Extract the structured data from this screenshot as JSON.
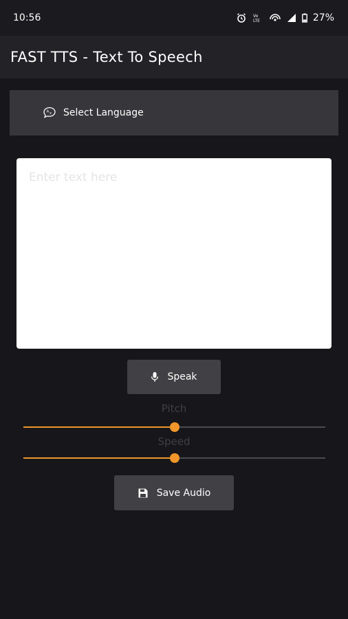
{
  "status_bar": {
    "time": "10:56",
    "network_label": "Vo)) LTE",
    "battery": "27%"
  },
  "app_bar": {
    "title": "FAST TTS - Text To Speech"
  },
  "language": {
    "label": "Select Language",
    "icon": "translate-chat-icon"
  },
  "text_input": {
    "placeholder": "Enter text here",
    "value": ""
  },
  "speak_button": {
    "label": "Speak",
    "icon": "mic-icon"
  },
  "pitch": {
    "label": "Pitch",
    "value": 0.5
  },
  "speed": {
    "label": "Speed",
    "value": 0.5
  },
  "save_button": {
    "label": "Save Audio",
    "icon": "save-icon"
  },
  "colors": {
    "accent": "#f0962a",
    "background": "#17171b",
    "app_bar": "#232327",
    "button": "#414145"
  }
}
